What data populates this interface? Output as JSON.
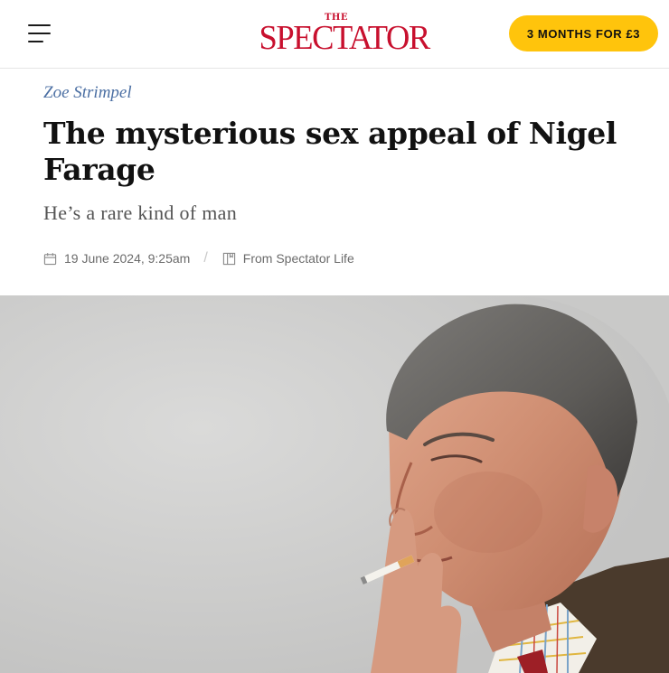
{
  "header": {
    "logo_the": "THE",
    "logo_name": "SPECTATOR",
    "cta_label": "3 MONTHS FOR £3"
  },
  "article": {
    "author": "Zoe Strimpel",
    "headline": "The mysterious sex appeal of Nigel Farage",
    "standfirst": "He’s a rare kind of man",
    "date": "19 June 2024, 9:25am",
    "separator": "/",
    "source": "From Spectator Life"
  },
  "colors": {
    "brand_red": "#c8102e",
    "cta_yellow": "#ffc40c",
    "author_blue": "#4b6fa3"
  },
  "icons": {
    "menu": "hamburger-menu-icon",
    "date": "calendar-icon",
    "source": "book-icon"
  }
}
